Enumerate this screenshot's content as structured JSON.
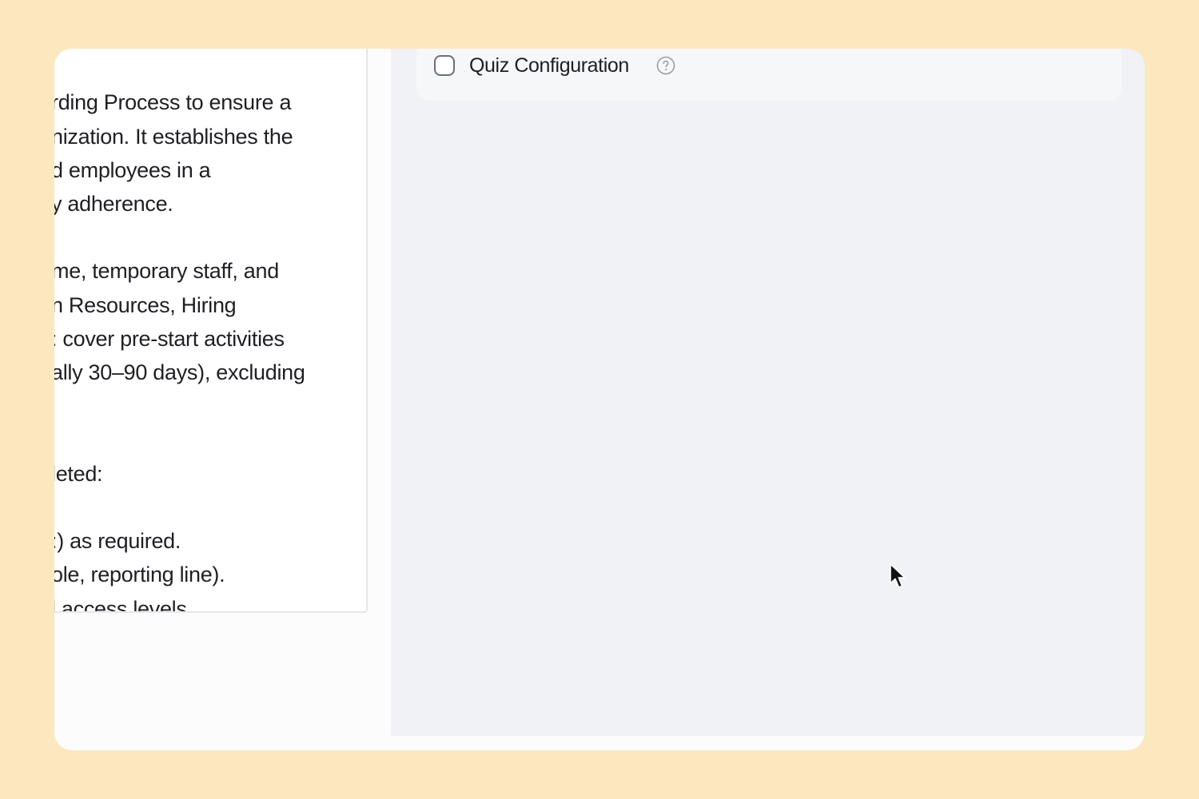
{
  "document": {
    "lines": [
      "rding Process to ensure a",
      "nization. It establishes the",
      "d employees in a",
      "y adherence.",
      "me, temporary staff, and",
      "n Resources, Hiring",
      ": cover pre-start activities",
      "ally 30–90 days), excluding",
      "leted:",
      ":) as required.",
      "ole, reporting line).",
      "l access levels"
    ]
  },
  "config": {
    "quiz_label": "Quiz Configuration",
    "quiz_checked": false,
    "help_icon": "question-circle-icon"
  },
  "colors": {
    "background": "#fbe8bf",
    "panel": "#f1f2f5"
  }
}
